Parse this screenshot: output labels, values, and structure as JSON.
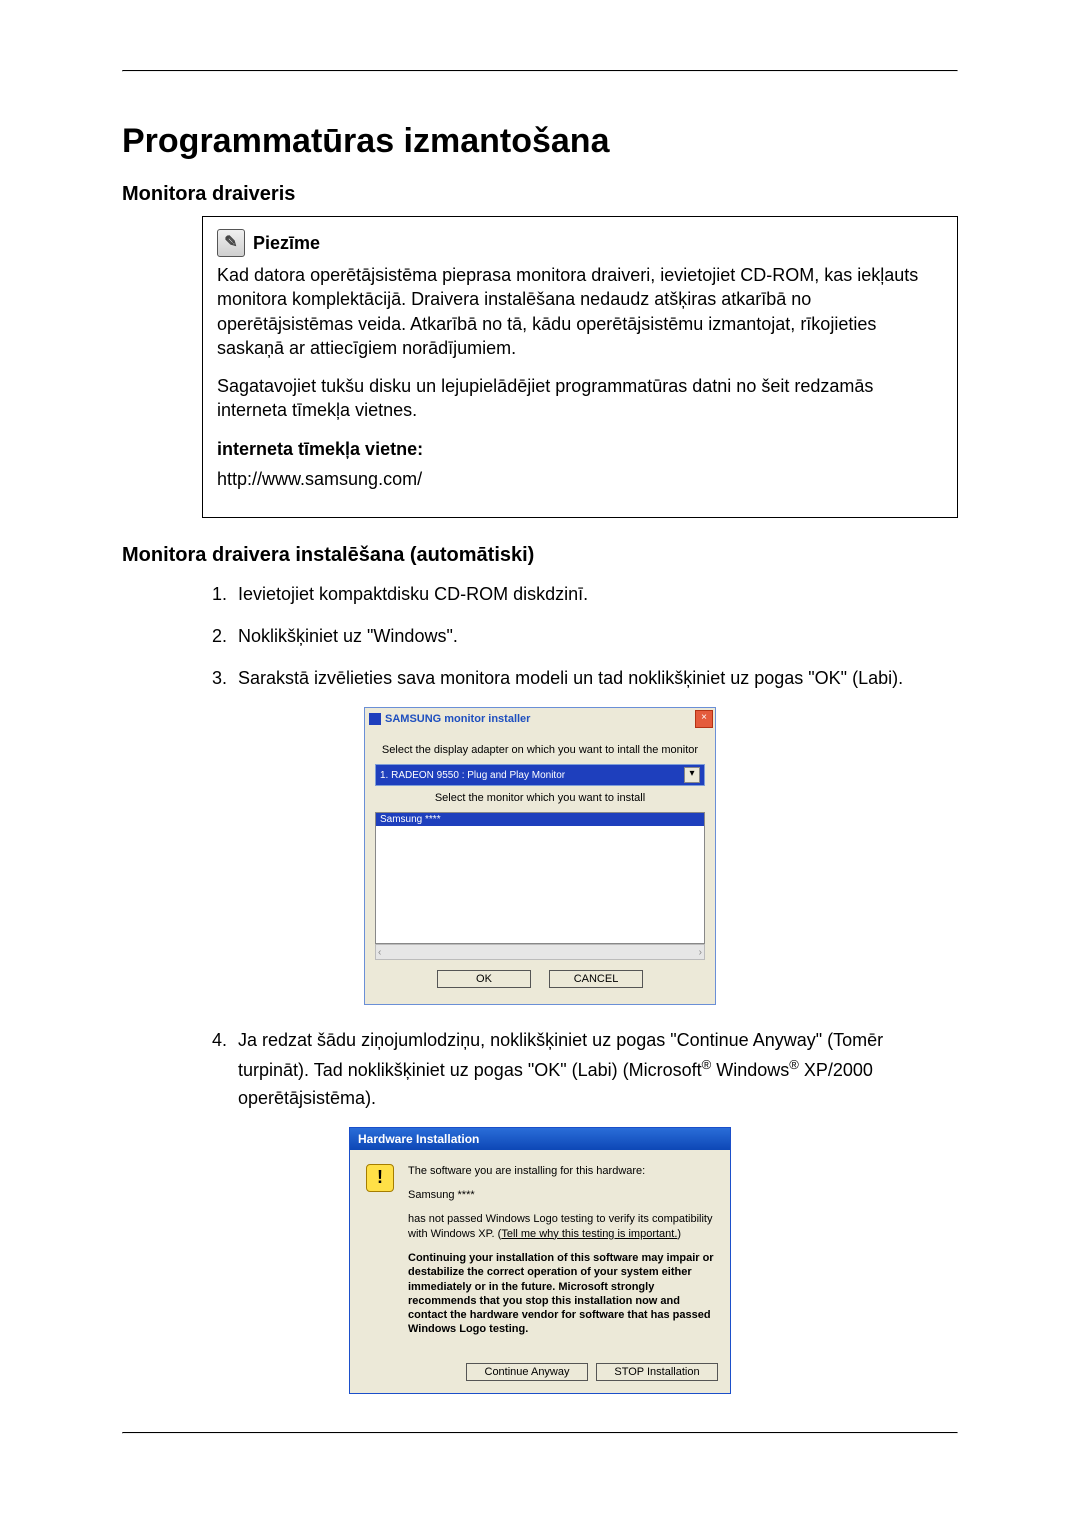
{
  "page_title": "Programmatūras izmantošana",
  "section1": "Monitora draiveris",
  "note": {
    "label": "Piezīme",
    "p1": "Kad datora operētājsistēma pieprasa monitora draiveri, ievietojiet CD-ROM, kas iekļauts monitora komplektācijā. Draivera instalēšana nedaudz atšķiras atkarībā no operētājsistēmas veida. Atkarībā no tā, kādu operētājsistēmu izmantojat, rīkojieties saskaņā ar attiecīgiem norādījumiem.",
    "p2": "Sagatavojiet tukšu disku un lejupielādējiet programmatūras datni no šeit redzamās interneta tīmekļa vietnes.",
    "link_label": "interneta tīmekļa vietne:",
    "url": "http://www.samsung.com/"
  },
  "section2": "Monitora draivera instalēšana (automātiski)",
  "steps": {
    "s1": "Ievietojiet kompaktdisku CD-ROM diskdzinī.",
    "s2": "Noklikšķiniet uz \"Windows\".",
    "s3": "Sarakstā izvēlieties sava monitora modeli un tad noklikšķiniet uz pogas \"OK\" (Labi).",
    "s4a": "Ja redzat šādu ziņojumlodziņu, noklikšķiniet uz pogas \"Continue Anyway\" (Tomēr turpināt). Tad noklikšķiniet uz pogas \"OK\" (Labi) (Microsoft",
    "s4b": " Windows",
    "s4c": " XP/2000 operētājsistēma)."
  },
  "installer": {
    "title": "SAMSUNG monitor installer",
    "instr1": "Select the display adapter on which you want to intall the monitor",
    "adapter": "1. RADEON 9550 : Plug and Play Monitor",
    "instr2": "Select the monitor which you want to install",
    "selected": "Samsung ****",
    "ok": "OK",
    "cancel": "CANCEL"
  },
  "hw": {
    "title": "Hardware Installation",
    "l1": "The software you are installing for this hardware:",
    "l2": "Samsung ****",
    "l3a": "has not passed Windows Logo testing to verify its compatibility with Windows XP. (",
    "l3link": "Tell me why this testing is important.",
    "l3b": ")",
    "l4": "Continuing your installation of this software may impair or destabilize the correct operation of your system either immediately or in the future. Microsoft strongly recommends that you stop this installation now and contact the hardware vendor for software that has passed Windows Logo testing.",
    "btn_continue": "Continue Anyway",
    "btn_stop": "STOP Installation"
  }
}
